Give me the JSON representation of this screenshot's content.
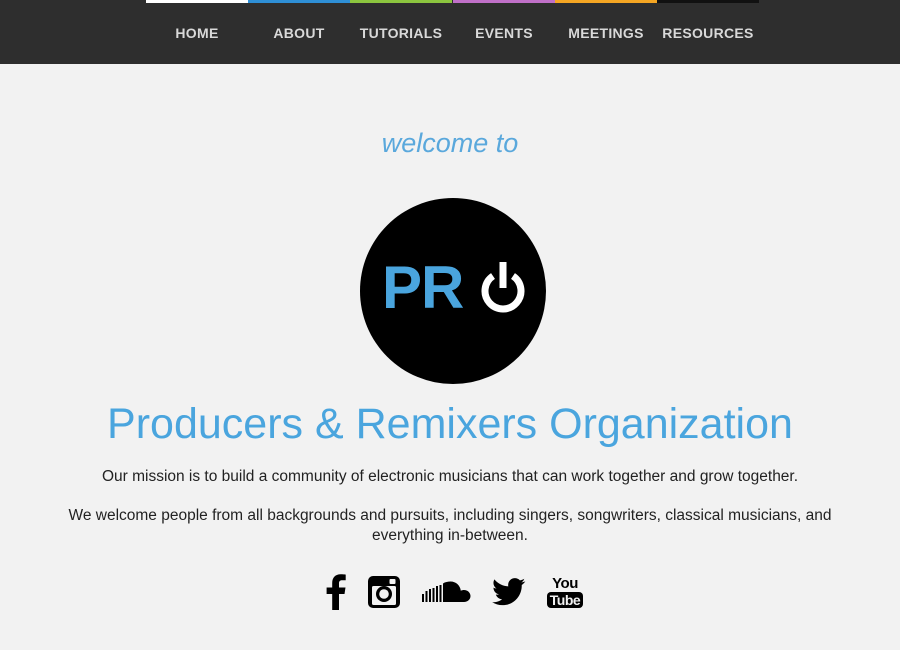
{
  "nav": {
    "items": [
      {
        "label": "HOME",
        "stripe_color": "#ffffff"
      },
      {
        "label": "ABOUT",
        "stripe_color": "#2e8fd6"
      },
      {
        "label": "TUTORIALS",
        "stripe_color": "#8cc63f"
      },
      {
        "label": "EVENTS",
        "stripe_color": "#c070c8"
      },
      {
        "label": "MEETINGS",
        "stripe_color": "#f5a623"
      },
      {
        "label": "RESOURCES",
        "stripe_color": "#111111"
      }
    ]
  },
  "hero": {
    "welcome": "welcome to",
    "logo_text": "PR",
    "org_name": "Producers & Remixers Organization",
    "mission": "Our mission is to build a community of electronic musicians that can work together and grow together.",
    "welcome_text": "We welcome people from all backgrounds and pursuits, including singers, songwriters, classical musicians, and everything in-between."
  },
  "social": {
    "icons": [
      "facebook-icon",
      "instagram-icon",
      "soundcloud-icon",
      "twitter-icon",
      "youtube-icon"
    ],
    "youtube_you": "You",
    "youtube_tube": "Tube"
  },
  "colors": {
    "accent": "#4aa5de",
    "nav_bg": "#2e2e2e",
    "page_bg": "#f2f2f2"
  }
}
